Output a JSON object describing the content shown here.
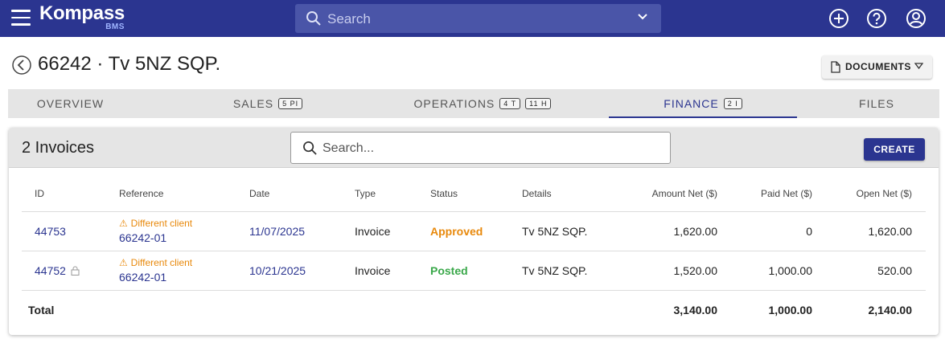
{
  "header": {
    "logo_name": "Kompass",
    "logo_sub": "BMS",
    "search_placeholder": "Search"
  },
  "page": {
    "title": "66242 · Tv 5NZ SQP.",
    "documents_label": "DOCUMENTS"
  },
  "tabs": [
    {
      "label": "OVERVIEW",
      "badges": []
    },
    {
      "label": "SALES",
      "badges": [
        "5 PI"
      ]
    },
    {
      "label": "OPERATIONS",
      "badges": [
        "4 T",
        "11 H"
      ]
    },
    {
      "label": "FINANCE",
      "badges": [
        "2 I"
      ],
      "active": true
    },
    {
      "label": "FILES",
      "badges": []
    }
  ],
  "invoices": {
    "title": "2 Invoices",
    "search_placeholder": "Search...",
    "create_label": "CREATE",
    "columns": [
      "ID",
      "Reference",
      "Date",
      "Type",
      "Status",
      "Details",
      "Amount Net ($)",
      "Paid Net ($)",
      "Open Net ($)"
    ],
    "rows": [
      {
        "id": "44753",
        "locked": false,
        "warning": "Different client",
        "reference": "66242-01",
        "date": "11/07/2025",
        "type": "Invoice",
        "status": "Approved",
        "details": "Tv 5NZ SQP.",
        "amount": "1,620.00",
        "paid": "0",
        "open": "1,620.00"
      },
      {
        "id": "44752",
        "locked": true,
        "warning": "Different client",
        "reference": "66242-01",
        "date": "10/21/2025",
        "type": "Invoice",
        "status": "Posted",
        "details": "Tv 5NZ SQP.",
        "amount": "1,520.00",
        "paid": "1,000.00",
        "open": "520.00"
      }
    ],
    "total": {
      "label": "Total",
      "amount": "3,140.00",
      "paid": "1,000.00",
      "open": "2,140.00"
    }
  },
  "colors": {
    "primary": "#2b3590",
    "approved": "#e8890c",
    "posted": "#3aa84a"
  },
  "icons": [
    "menu-icon",
    "search-icon",
    "chevron-down-icon",
    "add-circle-icon",
    "help-icon",
    "account-icon",
    "back-icon",
    "file-icon",
    "triangle-down-icon",
    "warning-icon",
    "lock-icon"
  ]
}
